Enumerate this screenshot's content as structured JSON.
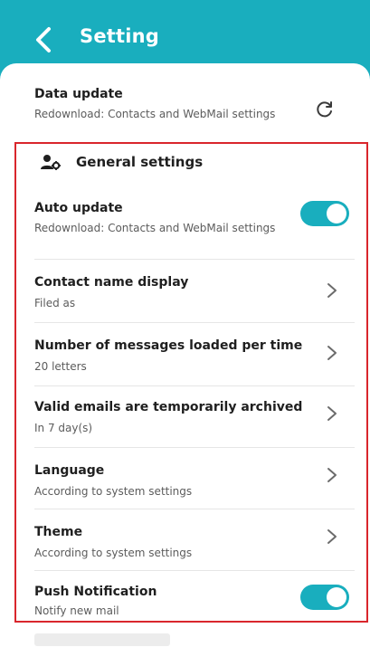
{
  "header": {
    "title": "Setting"
  },
  "data_update": {
    "title": "Data update",
    "subtitle": "Redownload: Contacts and WebMail settings"
  },
  "general": {
    "section_title": "General settings",
    "auto_update": {
      "title": "Auto update",
      "subtitle": "Redownload: Contacts and WebMail settings",
      "enabled": true
    },
    "contact_name_display": {
      "title": "Contact name display",
      "value": "Filed as"
    },
    "messages_per_time": {
      "title": "Number of messages loaded per time",
      "value": "20 letters"
    },
    "archive": {
      "title": "Valid emails are temporarily archived",
      "value": "In 7 day(s)"
    },
    "language": {
      "title": "Language",
      "value": "According to system settings"
    },
    "theme": {
      "title": "Theme",
      "value": "According to system settings"
    },
    "push_notification": {
      "title": "Push Notification",
      "subtitle": "Notify new mail",
      "enabled": true
    }
  },
  "colors": {
    "accent": "#19aebe",
    "highlight_border": "#d9262c"
  },
  "icons": {
    "back": "chevron-left-icon",
    "refresh": "refresh-icon",
    "section": "user-gear-icon",
    "row": "chevron-right-icon"
  }
}
